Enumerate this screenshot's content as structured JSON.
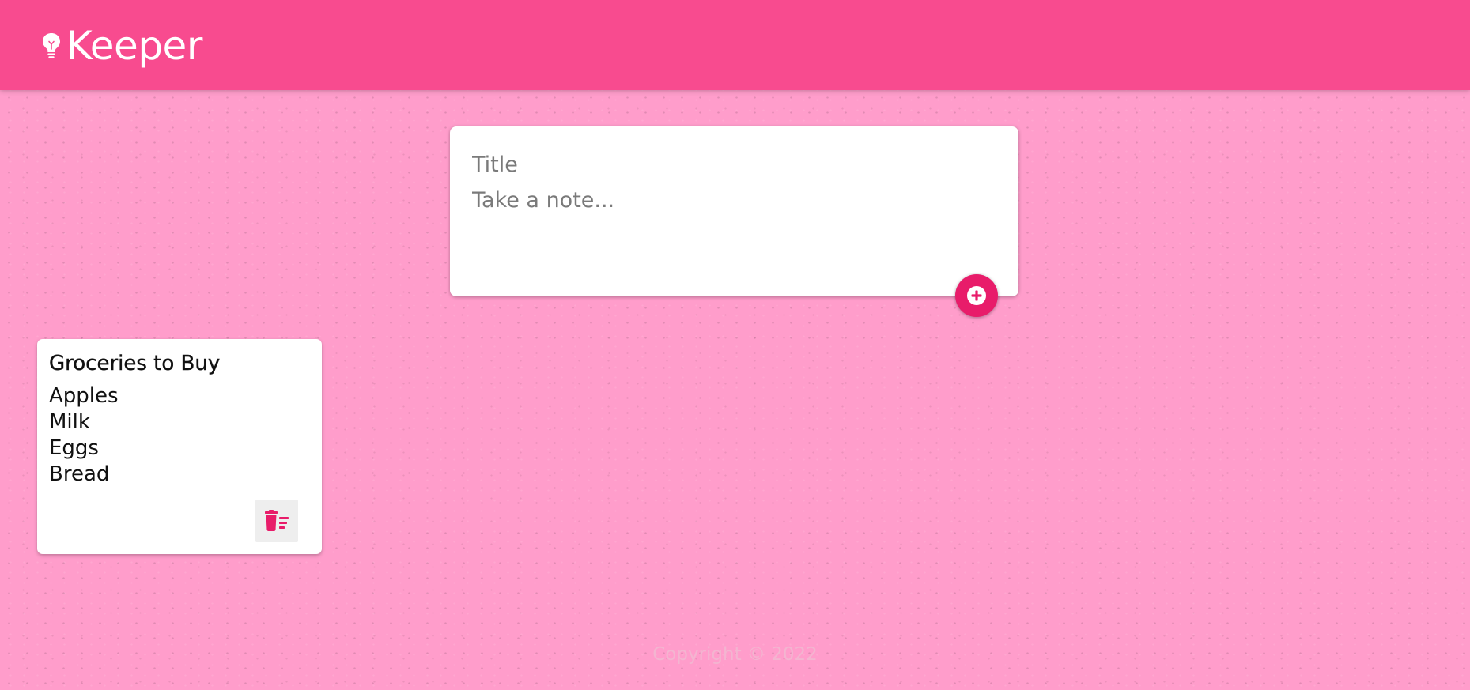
{
  "colors": {
    "header": "#f84b8f",
    "background": "#ff9dcb",
    "accent": "#e81c6a",
    "footer_text": "#f3b5d0"
  },
  "header": {
    "app_title": "Keeper",
    "logo_icon": "lightbulb-icon"
  },
  "create_area": {
    "title_placeholder": "Title",
    "content_placeholder": "Take a note...",
    "add_icon": "plus-circle-icon"
  },
  "notes": [
    {
      "title": "Groceries to Buy",
      "lines": [
        "Apples",
        "Milk",
        "Eggs",
        "Bread"
      ],
      "delete_icon": "delete-sweep-icon"
    }
  ],
  "footer": {
    "copyright": "Copyright © 2022"
  }
}
